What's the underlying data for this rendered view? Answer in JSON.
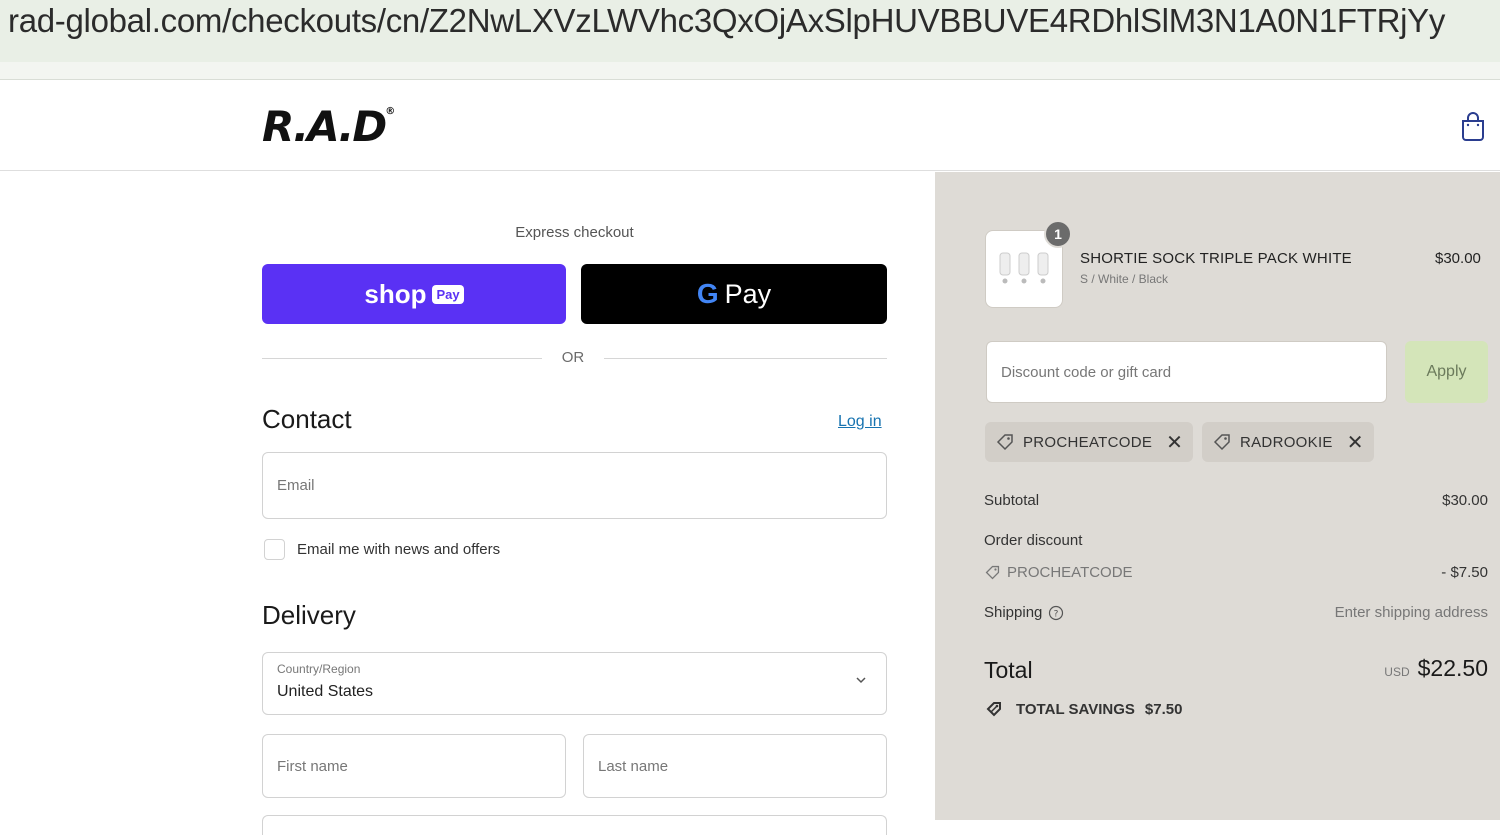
{
  "browser": {
    "url": "rad-global.com/checkouts/cn/Z2NwLXVzLWVhc3QxOjAxSlpHUVBBUVE4RDhlSlM3N1A0N1FTRjYy"
  },
  "header": {
    "logo_text": "R.A.D",
    "bag_icon": "shopping-bag-icon"
  },
  "express": {
    "label": "Express checkout",
    "shop_pay_text": "shop",
    "shop_pay_chip": "Pay",
    "gpay_g": "G",
    "gpay_text": "Pay",
    "or_text": "OR"
  },
  "contact": {
    "title": "Contact",
    "login_link": "Log in",
    "email_placeholder": "Email",
    "news_checkbox_label": "Email me with news and offers"
  },
  "delivery": {
    "title": "Delivery",
    "country_label": "Country/Region",
    "country_value": "United States",
    "first_name_placeholder": "First name",
    "last_name_placeholder": "Last name"
  },
  "summary": {
    "item": {
      "quantity": "1",
      "name": "SHORTIE SOCK TRIPLE PACK WHITE",
      "variant": "S / White / Black",
      "price": "$30.00"
    },
    "discount_placeholder": "Discount code or gift card",
    "apply_label": "Apply",
    "codes": [
      "PROCHEATCODE",
      "RADROOKIE"
    ],
    "subtotal_label": "Subtotal",
    "subtotal_value": "$30.00",
    "order_discount_label": "Order discount",
    "order_discount_code": "PROCHEATCODE",
    "order_discount_value": "- $7.50",
    "shipping_label": "Shipping",
    "shipping_value": "Enter shipping address",
    "total_label": "Total",
    "total_currency": "USD",
    "total_value": "$22.50",
    "savings_label": "TOTAL SAVINGS",
    "savings_value": "$7.50"
  },
  "colors": {
    "shop_pay": "#5a31f4",
    "gpay": "#000000",
    "link": "#1773b0",
    "summary_bg": "#dedbd6",
    "apply_bg": "#d4e5b9"
  }
}
